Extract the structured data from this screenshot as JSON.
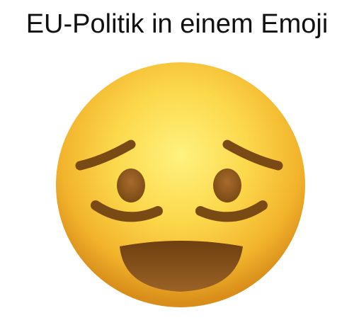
{
  "caption": "EU-Politik in einem Emoji",
  "emoji": {
    "icon": "awkward-smiling-face-emoji",
    "colors": {
      "face_light": "#FFEE7A",
      "face_mid": "#F9C73A",
      "face_dark": "#D88E1A",
      "features": "#7A4A14",
      "mouth_inner": "#8A5520"
    }
  }
}
